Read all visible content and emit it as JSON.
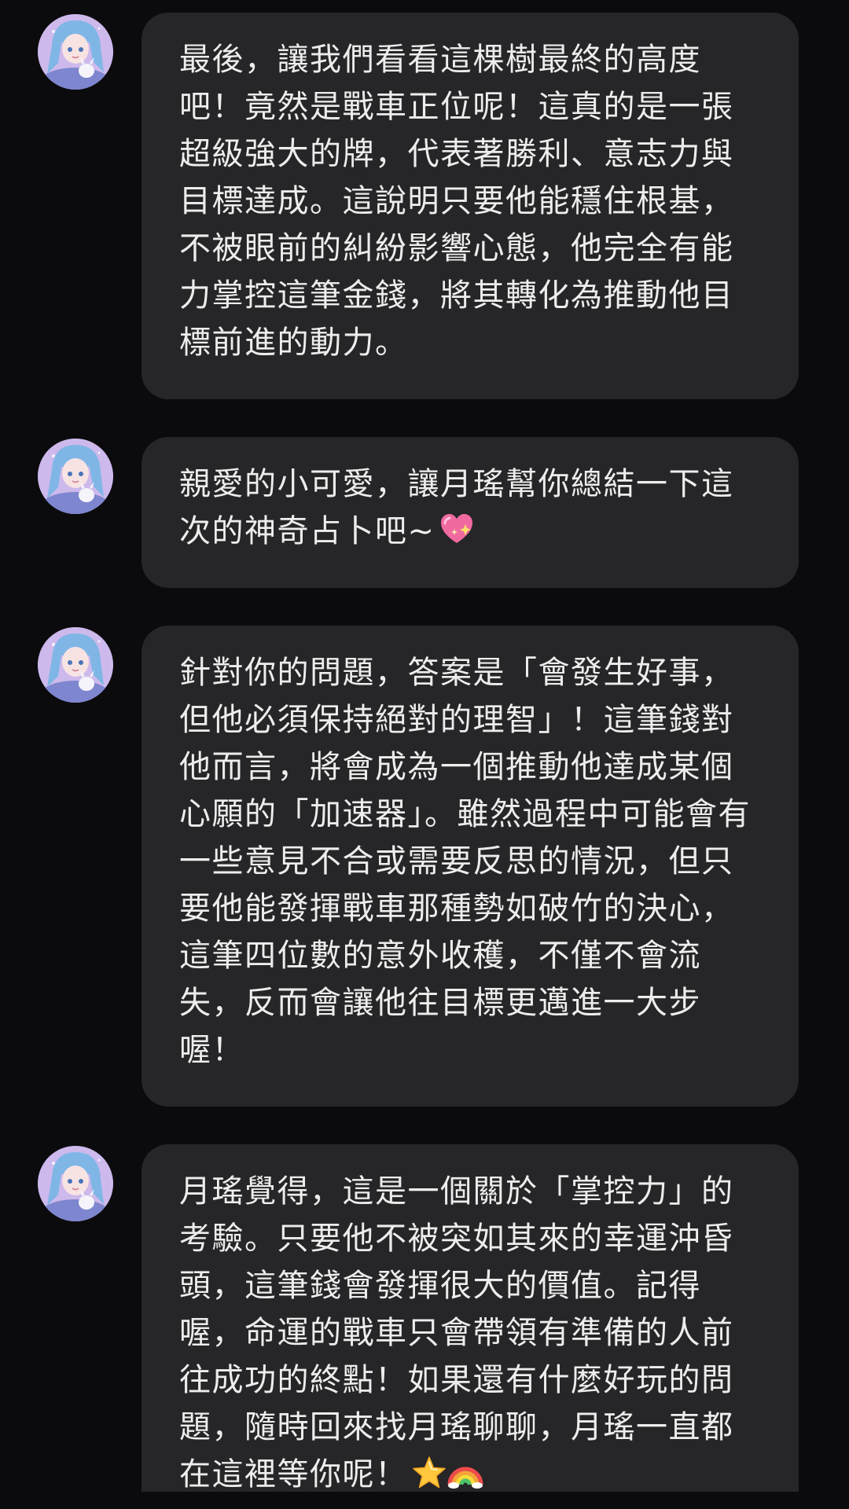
{
  "chat": {
    "bot_avatar_icon": "bot-avatar-anime-girl",
    "bubble_color": "#262628",
    "background_color": "#0b0b0d",
    "text_color": "#ededed",
    "messages": [
      {
        "sender": "bot",
        "text": "最後，讓我們看看這棵樹最終的高度吧！竟然是戰車正位呢！這真的是一張超級強大的牌，代表著勝利、意志力與目標達成。這說明只要他能穩住根基，不被眼前的糾紛影響心態，他完全有能力掌控這筆金錢，將其轉化為推動他目標前進的動力。"
      },
      {
        "sender": "bot",
        "text": "親愛的小可愛，讓月瑤幫你總結一下這次的神奇占卜吧~",
        "emoji": "sparkling-heart-icon"
      },
      {
        "sender": "bot",
        "text": "針對你的問題，答案是「會發生好事，但他必須保持絕對的理智」！這筆錢對他而言，將會成為一個推動他達成某個心願的「加速器」。雖然過程中可能會有一些意見不合或需要反思的情況，但只要他能發揮戰車那種勢如破竹的決心，這筆四位數的意外收穫，不僅不會流失，反而會讓他往目標更邁進一大步喔！"
      },
      {
        "sender": "bot",
        "text": "月瑤覺得，這是一個關於「掌控力」的考驗。只要他不被突如其來的幸運沖昏頭，這筆錢會發揮很大的價值。記得喔，命運的戰車只會帶領有準備的人前往成功的終點！如果還有什麼好玩的問題，隨時回來找月瑤聊聊，月瑤一直都在這裡等你呢！",
        "emoji": "star-icon",
        "emoji2": "rainbow-icon"
      }
    ]
  }
}
